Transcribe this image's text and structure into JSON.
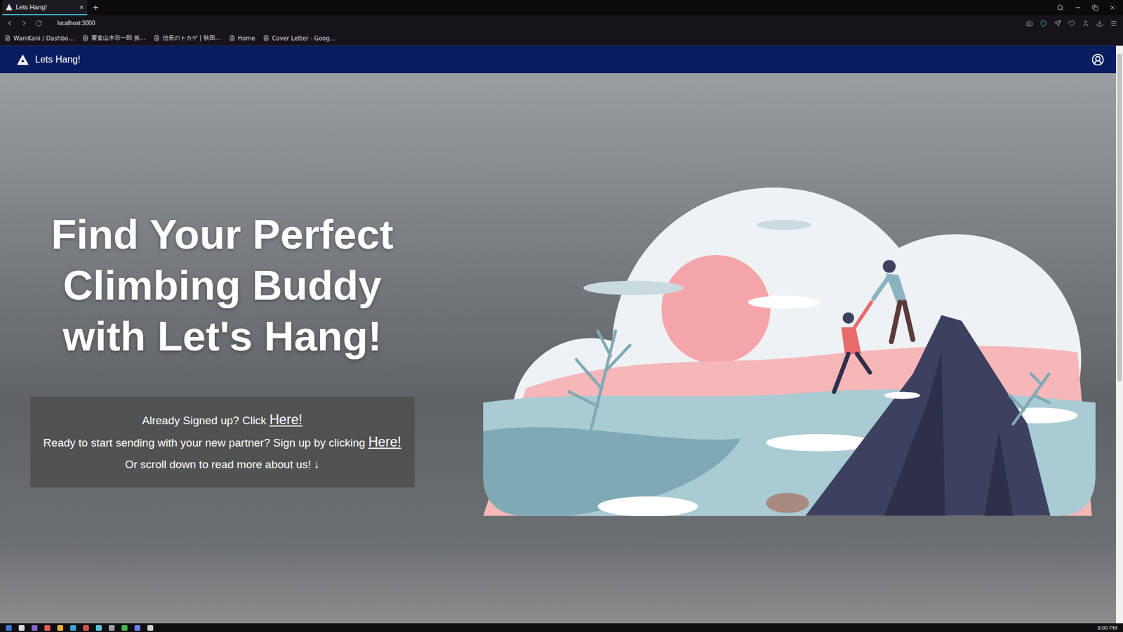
{
  "window": {
    "title": "Lets Hang!"
  },
  "browser": {
    "tabs": [
      {
        "label": "Lets Hang!",
        "close": "×",
        "selected": true
      }
    ],
    "new_tab": "+",
    "address": "localhost:3000",
    "bookmarks": [
      {
        "label": "WaniKani / Dashbo…"
      },
      {
        "label": "審査山本宗一郎 挨…"
      },
      {
        "label": "信長のトカゲ | 秋田…"
      },
      {
        "label": "Home"
      },
      {
        "label": "Cover Letter - Goog…"
      }
    ]
  },
  "navbar": {
    "brand": "Lets Hang!"
  },
  "hero": {
    "heading_lines": [
      "Find Your Perfect",
      "Climbing Buddy",
      "with Let's Hang!"
    ],
    "cta": [
      {
        "text": "Already Signed up? Click",
        "link": "Here!"
      },
      {
        "text": "Ready to start sending with your new partner? Sign up by clicking",
        "link": "Here!"
      },
      {
        "text": "Or scroll down to read more about us! ↓"
      }
    ]
  },
  "taskbar": {
    "time": "9:00 PM"
  }
}
